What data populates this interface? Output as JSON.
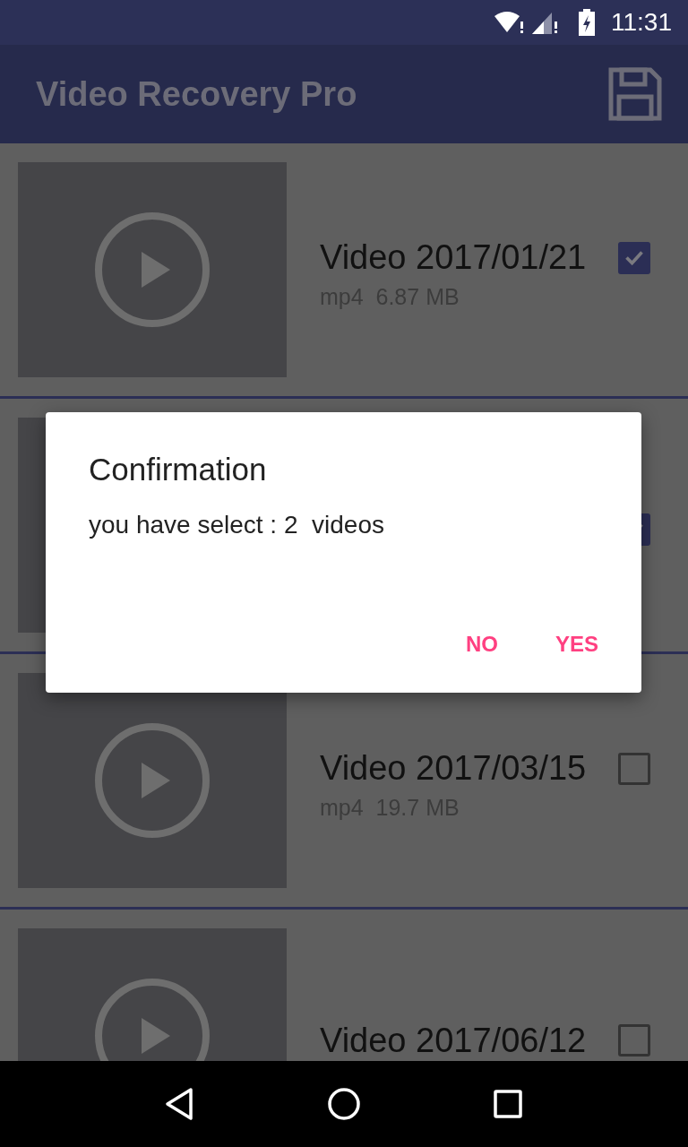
{
  "status_bar": {
    "time": "11:31"
  },
  "app_bar": {
    "title": "Video Recovery Pro"
  },
  "videos": [
    {
      "title": "Video 2017/01/21",
      "meta": "mp4  6.87 MB",
      "checked": true
    },
    {
      "checked": true
    },
    {
      "title": "Video 2017/03/15",
      "meta": "mp4  19.7 MB",
      "checked": false
    },
    {
      "title": "Video 2017/06/12",
      "checked": false
    }
  ],
  "dialog": {
    "title": "Confirmation",
    "message": "you have select : 2  videos",
    "buttons": [
      "NO",
      "YES"
    ]
  }
}
